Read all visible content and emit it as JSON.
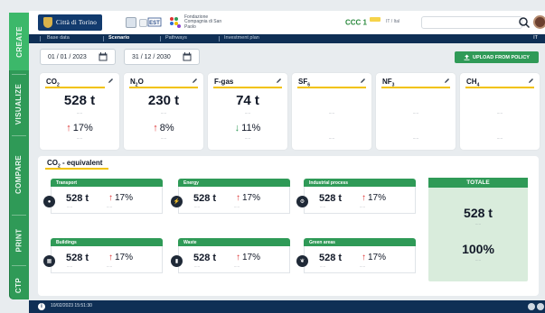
{
  "colors": {
    "brand_green": "#2f9a57",
    "navy": "#0f2f55",
    "accent_yellow": "#f2c200",
    "increase_red": "#dd3333"
  },
  "sidenav": [
    {
      "label": "CREATE"
    },
    {
      "label": "VISUALIZE"
    },
    {
      "label": "COMPARE"
    },
    {
      "label": "PRINT"
    },
    {
      "label": "CTP"
    }
  ],
  "header": {
    "logo_text": "Città di Torino",
    "ccc_label": "CCC 1",
    "lang_label": "IT / Ital",
    "search_placeholder": "",
    "partner2_text": "Fondazione Compagnia di San Paolo"
  },
  "tabs": [
    {
      "label": "Base data"
    },
    {
      "label": "Scenario"
    },
    {
      "label": "Pathways"
    },
    {
      "label": "Investment plan"
    }
  ],
  "tabbar_right": "IT",
  "dates": {
    "start": "01 / 01 / 2023",
    "end": "31 / 12 / 2030"
  },
  "upload_label": "UPLOAD FROM POLICY",
  "gases": [
    {
      "name": "CO",
      "sub": "2",
      "value": "528 t",
      "pct": "17%",
      "dir": "↑"
    },
    {
      "name": "N",
      "sub": "2",
      "name2": "O",
      "value": "230 t",
      "pct": "8%",
      "dir": "↑"
    },
    {
      "name": "F-gas",
      "value": "74 t",
      "pct": "11%",
      "dir": "↓"
    },
    {
      "name": "SF",
      "sub": "6"
    },
    {
      "name": "NF",
      "sub": "3"
    },
    {
      "name": "CH",
      "sub": "4"
    }
  ],
  "equiv_title": {
    "main": "CO",
    "sub": "2",
    "rest": " - equivalent"
  },
  "sectors": [
    {
      "label": "Transport",
      "value": "528 t",
      "pct": "17%"
    },
    {
      "label": "Energy",
      "value": "528 t",
      "pct": "17%"
    },
    {
      "label": "Industrial process",
      "value": "528 t",
      "pct": "17%"
    },
    {
      "label": "Buildings",
      "value": "528 t",
      "pct": "17%"
    },
    {
      "label": "Waste",
      "value": "528 t",
      "pct": "17%"
    },
    {
      "label": "Green areas",
      "value": "528 t",
      "pct": "17%"
    }
  ],
  "totale": {
    "label": "TOTALE",
    "value": "528 t",
    "pct": "100%"
  },
  "footer": {
    "timestamp": "10/02/2023 15:51:30"
  }
}
